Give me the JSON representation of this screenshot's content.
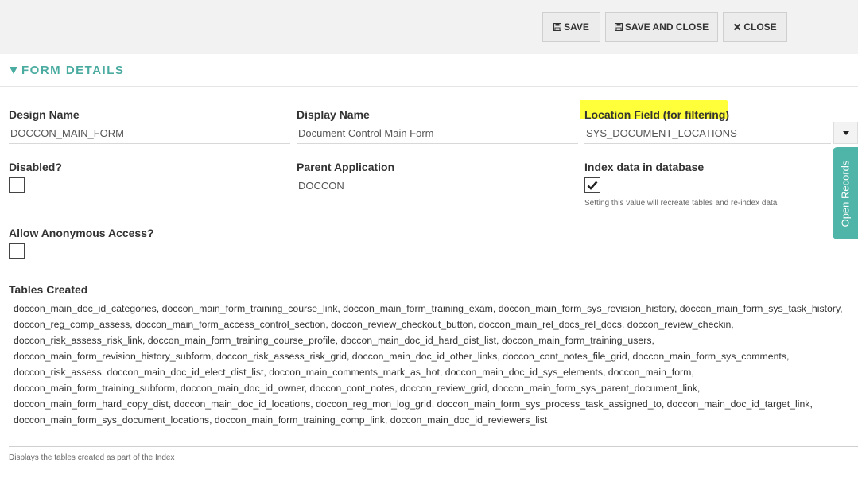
{
  "toolbar": {
    "save_label": "SAVE",
    "save_close_label": "SAVE AND CLOSE",
    "close_label": "CLOSE"
  },
  "section": {
    "title": "FORM DETAILS"
  },
  "fields": {
    "design_name": {
      "label": "Design Name",
      "value": "DOCCON_MAIN_FORM"
    },
    "display_name": {
      "label": "Display Name",
      "value": "Document Control Main Form"
    },
    "location_field": {
      "label": "Location Field (for filtering)",
      "value": "SYS_DOCUMENT_LOCATIONS"
    },
    "disabled": {
      "label": "Disabled?",
      "checked": false
    },
    "parent_application": {
      "label": "Parent Application",
      "value": "DOCCON"
    },
    "index_data": {
      "label": "Index data in database",
      "checked": true,
      "help": "Setting this value will recreate tables and re-index data"
    },
    "anonymous": {
      "label": "Allow Anonymous Access?",
      "checked": false
    }
  },
  "tables": {
    "label": "Tables Created",
    "text": "doccon_main_doc_id_categories, doccon_main_form_training_course_link, doccon_main_form_training_exam, doccon_main_form_sys_revision_history, doccon_main_form_sys_task_history, doccon_reg_comp_assess, doccon_main_form_access_control_section, doccon_review_checkout_button, doccon_main_rel_docs_rel_docs, doccon_review_checkin, doccon_risk_assess_risk_link, doccon_main_form_training_course_profile, doccon_main_doc_id_hard_dist_list, doccon_main_form_training_users, doccon_main_form_revision_history_subform, doccon_risk_assess_risk_grid, doccon_main_doc_id_other_links, doccon_cont_notes_file_grid, doccon_main_form_sys_comments, doccon_risk_assess, doccon_main_doc_id_elect_dist_list, doccon_main_comments_mark_as_hot, doccon_main_doc_id_sys_elements, doccon_main_form, doccon_main_form_training_subform, doccon_main_doc_id_owner, doccon_cont_notes, doccon_review_grid, doccon_main_form_sys_parent_document_link, doccon_main_form_hard_copy_dist, doccon_main_doc_id_locations, doccon_reg_mon_log_grid, doccon_main_form_sys_process_task_assigned_to, doccon_main_doc_id_target_link, doccon_main_form_sys_document_locations, doccon_main_form_training_comp_link, doccon_main_doc_id_reviewers_list",
    "help": "Displays the tables created as part of the Index"
  },
  "side_tab": {
    "label": "Open Records"
  },
  "icons": {
    "save": "floppy-disk-icon",
    "close": "x-icon",
    "check": "checkmark-icon",
    "dropdown": "caret-down-icon",
    "section": "triangle-down-icon"
  },
  "colors": {
    "accent": "#4aaba0",
    "highlight": "#ffff3a"
  }
}
